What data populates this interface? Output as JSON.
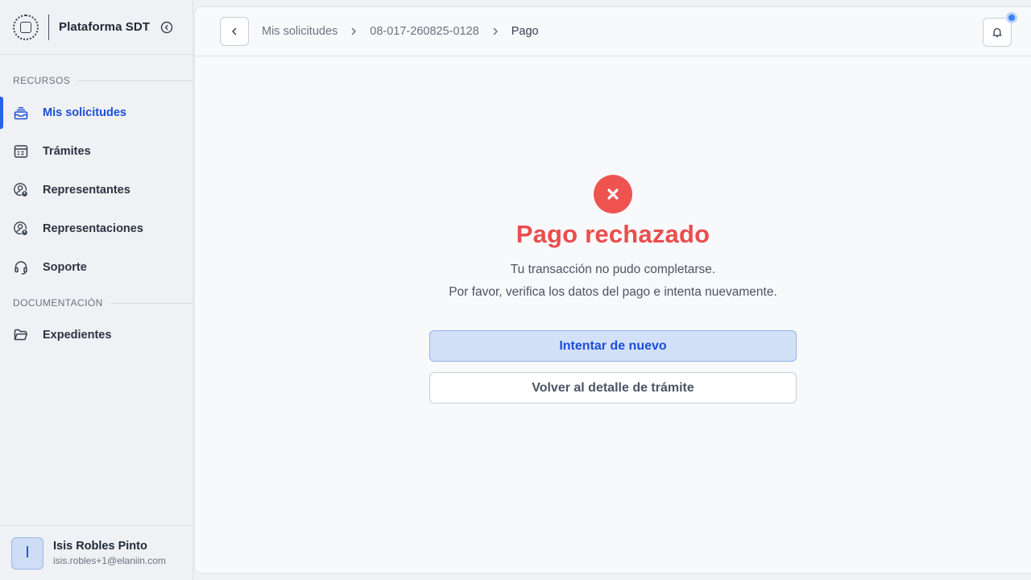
{
  "app": {
    "title": "Plataforma SDT"
  },
  "sidebar": {
    "sections": [
      {
        "label": "RECURSOS"
      },
      {
        "label": "DOCUMENTACIÓN"
      }
    ],
    "items": [
      {
        "label": "Mis solicitudes",
        "icon": "inbox-stack-icon",
        "active": true
      },
      {
        "label": "Trámites",
        "icon": "calendar-table-icon"
      },
      {
        "label": "Representantes",
        "icon": "user-badge-icon"
      },
      {
        "label": "Representaciones",
        "icon": "user-badge-icon"
      },
      {
        "label": "Soporte",
        "icon": "headset-icon"
      },
      {
        "label": "Expedientes",
        "icon": "folder-open-icon"
      }
    ]
  },
  "user": {
    "initial": "I",
    "name": "Isis Robles Pinto",
    "email": "isis.robles+1@elaniin.com"
  },
  "breadcrumb": [
    "Mis solicitudes",
    "08-017-260825-0128",
    "Pago"
  ],
  "notification": {
    "has_unread": true,
    "dot_color": "#3b82f6"
  },
  "result": {
    "title": "Pago rechazado",
    "line1": "Tu transacción no pudo completarse.",
    "line2": "Por favor, verifica los datos del pago e intenta nuevamente.",
    "status_color": "#ef5350"
  },
  "actions": {
    "retry_label": "Intentar de nuevo",
    "back_label": "Volver al detalle de trámite"
  },
  "colors": {
    "accent": "#2563eb",
    "error": "#ea4d4d"
  }
}
